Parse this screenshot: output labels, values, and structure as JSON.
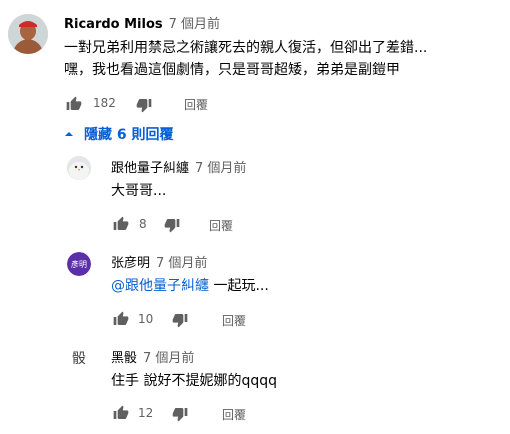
{
  "comment": {
    "author": "Ricardo Milos",
    "time": "7 個月前",
    "lines": [
      "一對兄弟利用禁忌之術讓死去的親人復活，但卻出了差錯...",
      "嘿，我也看過這個劇情，只是哥哥超矮，弟弟是副鎧甲"
    ],
    "likes": "182",
    "reply_label": "回覆"
  },
  "replies_toggle": {
    "label": "隱藏 6 則回覆"
  },
  "replies": [
    {
      "author": "跟他量子糾纏",
      "time": "7 個月前",
      "text": "大哥哥...",
      "mention": "",
      "likes": "8",
      "reply_label": "回覆"
    },
    {
      "author": "张彦明",
      "avatar_text": "彥明",
      "avatar_color": "#5b2fa8",
      "time": "7 個月前",
      "text": "一起玩...",
      "mention": "@跟他量子糾纏",
      "likes": "10",
      "reply_label": "回覆"
    },
    {
      "author": "黑骰",
      "avatar_text": "骰",
      "time": "7 個月前",
      "text": "住手 說好不提妮娜的qqqq",
      "mention": "",
      "likes": "12",
      "reply_label": "回覆"
    }
  ]
}
